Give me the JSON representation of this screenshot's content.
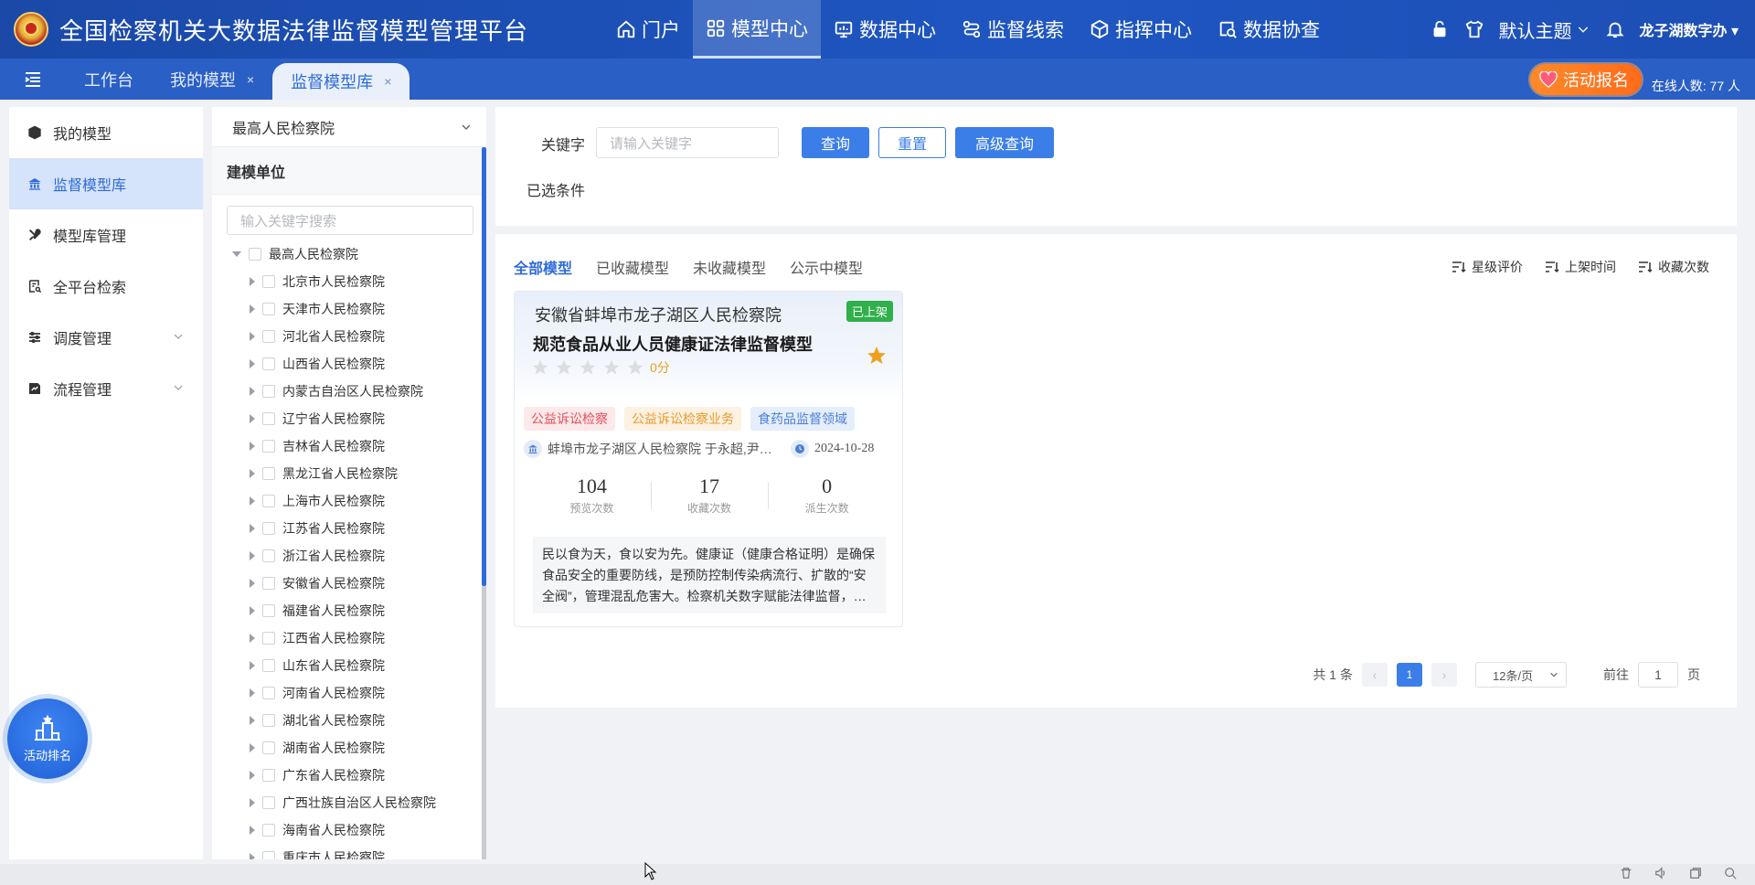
{
  "header": {
    "title": "全国检察机关大数据法律监督模型管理平台",
    "nav": [
      {
        "label": "门户",
        "icon": "home-icon"
      },
      {
        "label": "模型中心",
        "icon": "grid-icon",
        "active": true
      },
      {
        "label": "数据中心",
        "icon": "monitor-icon"
      },
      {
        "label": "监督线索",
        "icon": "route-icon"
      },
      {
        "label": "指挥中心",
        "icon": "cube-icon"
      },
      {
        "label": "数据协查",
        "icon": "data-search-icon"
      }
    ],
    "theme_label": "默认主题",
    "user": "龙子湖数字办"
  },
  "tabbar": {
    "tabs": [
      {
        "label": "工作台",
        "closable": false
      },
      {
        "label": "我的模型",
        "closable": true
      },
      {
        "label": "监督模型库",
        "closable": true,
        "active": true
      }
    ],
    "close_glyph": "×",
    "event_label": "活动报名",
    "online_text": "在线人数: 77 人"
  },
  "sidebar": {
    "items": [
      {
        "label": "我的模型",
        "icon": "cube-icon"
      },
      {
        "label": "监督模型库",
        "icon": "bank-icon",
        "active": true
      },
      {
        "label": "模型库管理",
        "icon": "tools-icon"
      },
      {
        "label": "全平台检索",
        "icon": "search-doc-icon"
      },
      {
        "label": "调度管理",
        "icon": "sliders-icon",
        "expandable": true
      },
      {
        "label": "流程管理",
        "icon": "flow-icon",
        "expandable": true
      }
    ]
  },
  "tree": {
    "org_selected": "最高人民检察院",
    "heading": "建模单位",
    "search_placeholder": "输入关键字搜索",
    "root": "最高人民检察院",
    "children": [
      "北京市人民检察院",
      "天津市人民检察院",
      "河北省人民检察院",
      "山西省人民检察院",
      "内蒙古自治区人民检察院",
      "辽宁省人民检察院",
      "吉林省人民检察院",
      "黑龙江省人民检察院",
      "上海市人民检察院",
      "江苏省人民检察院",
      "浙江省人民检察院",
      "安徽省人民检察院",
      "福建省人民检察院",
      "江西省人民检察院",
      "山东省人民检察院",
      "河南省人民检察院",
      "湖北省人民检察院",
      "湖南省人民检察院",
      "广东省人民检察院",
      "广西壮族自治区人民检察院",
      "海南省人民检察院",
      "重庆市人民检察院"
    ]
  },
  "filter": {
    "keyword_label": "关键字",
    "keyword_placeholder": "请输入关键字",
    "search_btn": "查询",
    "reset_btn": "重置",
    "advanced_btn": "高级查询",
    "selected_label": "已选条件"
  },
  "list": {
    "subtabs": [
      "全部模型",
      "已收藏模型",
      "未收藏模型",
      "公示中模型"
    ],
    "sorts": [
      "星级评价",
      "上架时间",
      "收藏次数"
    ],
    "cards": [
      {
        "org": "安徽省蚌埠市龙子湖区人民检察院",
        "status": "已上架",
        "title": "规范食品从业人员健康证法律监督模型",
        "rating": 0,
        "score_text": "0分",
        "tags": [
          "公益诉讼检察",
          "公益诉讼检察业务",
          "食药品监督领域"
        ],
        "author": "蚌埠市龙子湖区人民检察院 于永超,尹…",
        "date": "2024-10-28",
        "stats": [
          {
            "num": "104",
            "label": "预览次数"
          },
          {
            "num": "17",
            "label": "收藏次数"
          },
          {
            "num": "0",
            "label": "派生次数"
          }
        ],
        "desc": "民以食为天，食以安为先。健康证（健康合格证明）是确保食品安全的重要防线，是预防控制传染病流行、扩散的“安全阀”，管理混乱危害大。检察机关数字赋能法律监督，…"
      }
    ]
  },
  "pager": {
    "total_text": "共 1 条",
    "current": "1",
    "prev_glyph": "‹",
    "next_glyph": "›",
    "size_text": "12条/页",
    "goto_prefix": "前往",
    "goto_value": "1",
    "goto_suffix": "页"
  },
  "fab": {
    "label": "活动排名"
  },
  "colors": {
    "primary": "#3b7ee8",
    "header": "#1f56c2",
    "online_badge": "#2fb04a",
    "star": "#f0a020"
  }
}
